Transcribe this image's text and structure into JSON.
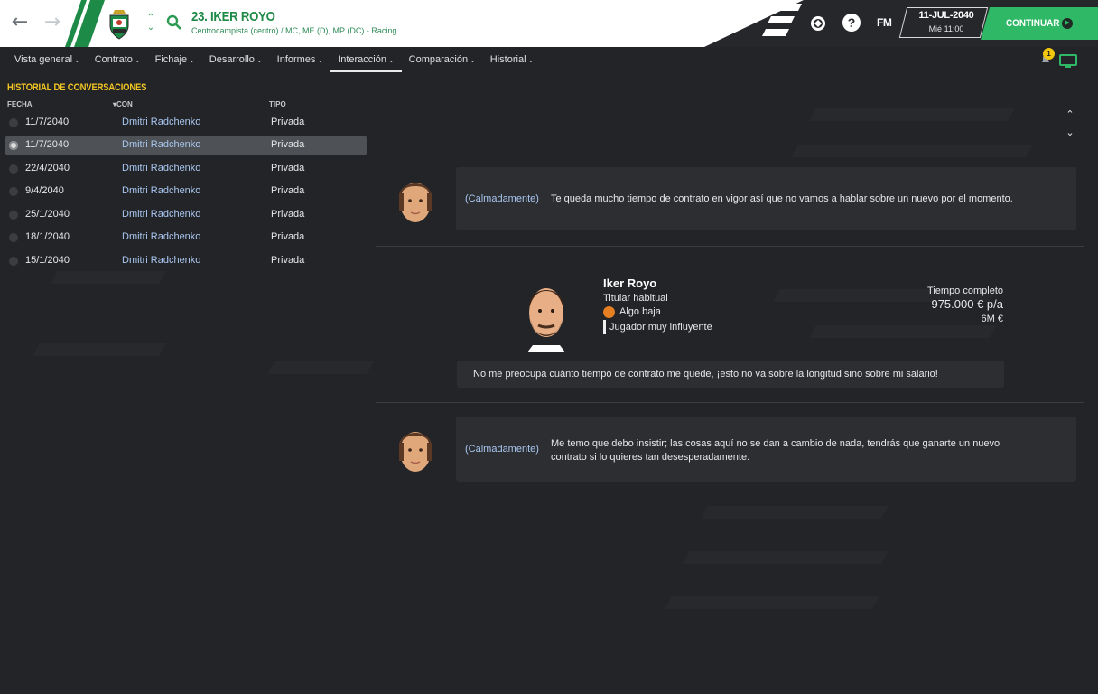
{
  "topbar": {
    "player_title": "23. IKER ROYO",
    "player_subtitle": "Centrocampista (centro) / MC, ME (D), MP (DC) - Racing",
    "fm_logo": "FM",
    "help_label": "?",
    "date_main": "11-JUL-2040",
    "date_sub": "Mié 11:00",
    "continue_label": "CONTINUAR",
    "accent_color": "#2fb865"
  },
  "tabs": [
    {
      "label": "Vista general",
      "active": false
    },
    {
      "label": "Contrato",
      "active": false
    },
    {
      "label": "Fichaje",
      "active": false
    },
    {
      "label": "Desarrollo",
      "active": false
    },
    {
      "label": "Informes",
      "active": false
    },
    {
      "label": "Interacción",
      "active": true
    },
    {
      "label": "Comparación",
      "active": false
    },
    {
      "label": "Historial",
      "active": false
    }
  ],
  "notifications": {
    "badge": "1"
  },
  "history": {
    "title": "HISTORIAL DE CONVERSACIONES",
    "columns": {
      "date": "FECHA",
      "with": "CON",
      "type": "TIPO"
    },
    "rows": [
      {
        "date": "11/7/2040",
        "with": "Dmitri Radchenko",
        "type": "Privada"
      },
      {
        "date": "11/7/2040",
        "with": "Dmitri Radchenko",
        "type": "Privada",
        "selected": true
      },
      {
        "date": "22/4/2040",
        "with": "Dmitri Radchenko",
        "type": "Privada"
      },
      {
        "date": "9/4/2040",
        "with": "Dmitri Radchenko",
        "type": "Privada"
      },
      {
        "date": "25/1/2040",
        "with": "Dmitri Radchenko",
        "type": "Privada"
      },
      {
        "date": "18/1/2040",
        "with": "Dmitri Radchenko",
        "type": "Privada"
      },
      {
        "date": "15/1/2040",
        "with": "Dmitri Radchenko",
        "type": "Privada"
      }
    ]
  },
  "conversation": {
    "msg1": {
      "tone": "(Calmadamente)",
      "text": "Te queda mucho tiempo de contrato en vigor así que no vamos a hablar sobre un nuevo por el momento."
    },
    "player": {
      "name": "Iker Royo",
      "role": "Titular habitual",
      "mood": "Algo baja",
      "influence": "Jugador muy influyente",
      "contract_type": "Tiempo completo",
      "wage": "975.000 € p/a",
      "value": "6M €",
      "reply": "No me preocupa cuánto tiempo de contrato me quede, ¡esto no va sobre la longitud sino sobre mi salario!"
    },
    "msg2": {
      "tone": "(Calmadamente)",
      "text_line1": "Me temo que debo insistir; las cosas aquí no se dan a cambio de nada, tendrás que ganarte un nuevo",
      "text_line2": "contrato si lo quieres tan desesperadamente."
    }
  }
}
